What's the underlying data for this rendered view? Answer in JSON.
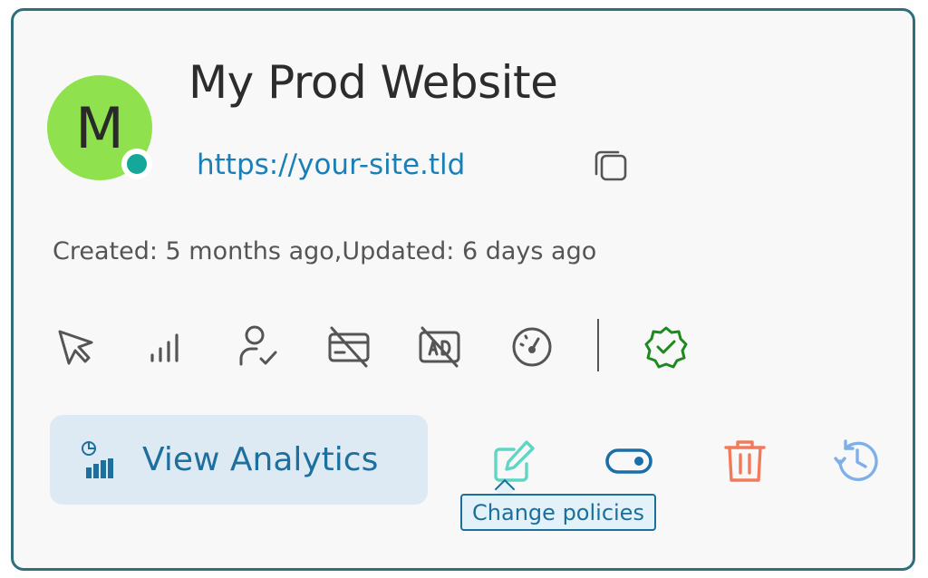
{
  "site": {
    "avatar_letter": "M",
    "title": "My Prod Website",
    "url": "https://your-site.tld"
  },
  "meta": {
    "created": "Created: 5 months ago,",
    "updated": "Updated: 6 days ago"
  },
  "features": [
    "cursor-icon",
    "signal-bars-icon",
    "user-check-icon",
    "card-off-icon",
    "ad-off-icon",
    "speedometer-icon",
    "verified-badge-icon"
  ],
  "actions": {
    "view_analytics": "View Analytics",
    "tooltip": "Change policies"
  },
  "colors": {
    "border": "#2f6f7c",
    "avatar": "#8fe14e",
    "status": "#14a79a",
    "link": "#1b7fb7",
    "verified": "#1d8a1d",
    "edit": "#5fd6c4",
    "delete": "#f07a5a",
    "history": "#7db0e8"
  }
}
